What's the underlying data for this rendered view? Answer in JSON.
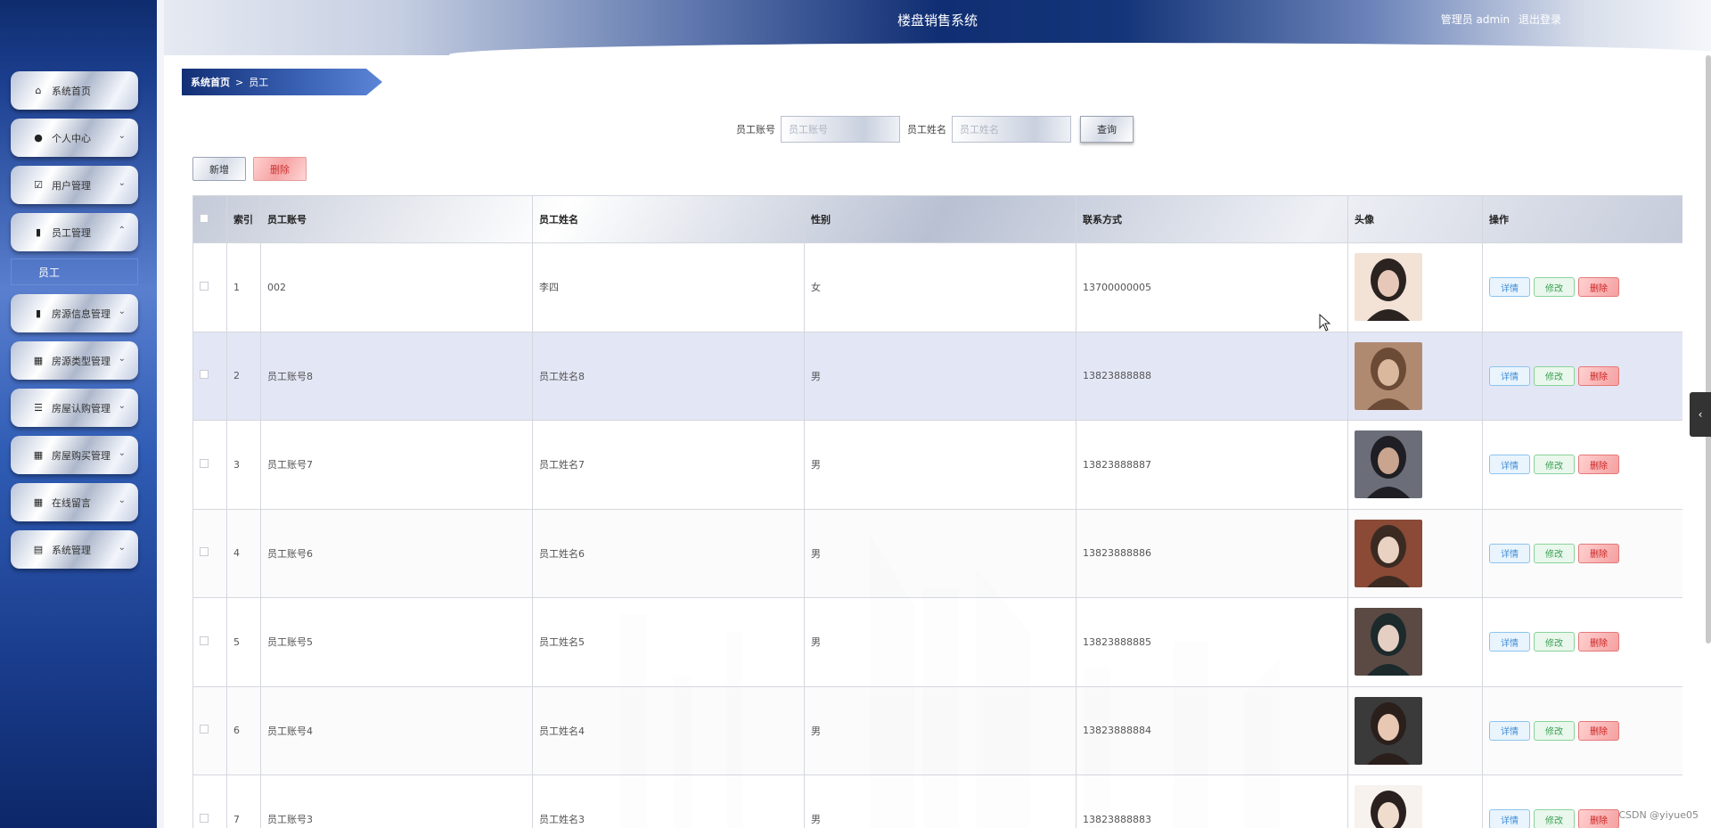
{
  "header": {
    "title": "楼盘销售系统",
    "user": "管理员 admin",
    "logout": "退出登录"
  },
  "sidebar": {
    "items": [
      {
        "label": "系统首页",
        "icon": "home-icon",
        "chevron": false
      },
      {
        "label": "个人中心",
        "icon": "user-icon",
        "chevron": "down"
      },
      {
        "label": "用户管理",
        "icon": "check-square-icon",
        "chevron": "down"
      },
      {
        "label": "员工管理",
        "icon": "bar-chart-icon",
        "chevron": "up"
      },
      {
        "label": "房源信息管理",
        "icon": "bar-chart-icon",
        "chevron": "down"
      },
      {
        "label": "房源类型管理",
        "icon": "grid-icon",
        "chevron": "down"
      },
      {
        "label": "房屋认购管理",
        "icon": "list-icon",
        "chevron": "down"
      },
      {
        "label": "房屋购买管理",
        "icon": "grid-icon",
        "chevron": "down"
      },
      {
        "label": "在线留言",
        "icon": "grid-icon",
        "chevron": "down"
      },
      {
        "label": "系统管理",
        "icon": "clipboard-icon",
        "chevron": "down"
      }
    ],
    "active_sub": "员工"
  },
  "breadcrumb": {
    "home": "系统首页",
    "sep": ">",
    "current": "员工"
  },
  "search": {
    "account_label": "员工账号",
    "account_placeholder": "员工账号",
    "name_label": "员工姓名",
    "name_placeholder": "员工姓名",
    "query_button": "查询"
  },
  "actions": {
    "add": "新增",
    "delete": "删除"
  },
  "table": {
    "headers": {
      "index": "索引",
      "account": "员工账号",
      "name": "员工姓名",
      "gender": "性别",
      "phone": "联系方式",
      "avatar": "头像",
      "ops": "操作"
    },
    "rows": [
      {
        "index": "1",
        "account": "002",
        "name": "李四",
        "gender": "女",
        "phone": "13700000005"
      },
      {
        "index": "2",
        "account": "员工账号8",
        "name": "员工姓名8",
        "gender": "男",
        "phone": "13823888888"
      },
      {
        "index": "3",
        "account": "员工账号7",
        "name": "员工姓名7",
        "gender": "男",
        "phone": "13823888887"
      },
      {
        "index": "4",
        "account": "员工账号6",
        "name": "员工姓名6",
        "gender": "男",
        "phone": "13823888886"
      },
      {
        "index": "5",
        "account": "员工账号5",
        "name": "员工姓名5",
        "gender": "男",
        "phone": "13823888885"
      },
      {
        "index": "6",
        "account": "员工账号4",
        "name": "员工姓名4",
        "gender": "男",
        "phone": "13823888884"
      },
      {
        "index": "7",
        "account": "员工账号3",
        "name": "员工姓名3",
        "gender": "男",
        "phone": "13823888883"
      }
    ],
    "op_labels": {
      "detail": "详情",
      "edit": "修改",
      "delete": "删除"
    }
  },
  "watermark": "CSDN @yiyue05",
  "colors": {
    "nav_dark": "#0e2c6e",
    "header_mid": "#102e73",
    "detail": "#3f8ed8",
    "edit": "#3aa153",
    "delete": "#cc2222"
  }
}
